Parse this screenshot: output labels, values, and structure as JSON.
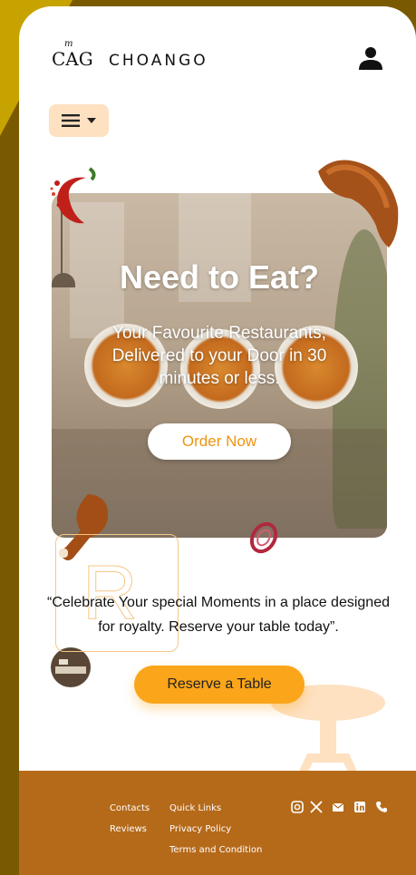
{
  "brand": {
    "mark": "CAG",
    "mark_sub": "m",
    "name": "CHOANGO"
  },
  "header": {
    "user_icon": "user-icon",
    "menu_icon": "hamburger-icon"
  },
  "hero": {
    "title": "Need to Eat?",
    "subtitle": "Your Favourite Restaurants, Delivered to your Door in 30 minutes or less.",
    "cta": "Order Now"
  },
  "quote": {
    "letter": "R",
    "text": "“Celebrate Your special Moments in a place designed for royalty. Reserve your  table today”."
  },
  "reserve": {
    "label": "Reserve a Table"
  },
  "footer": {
    "col1": [
      "Contacts",
      "Reviews"
    ],
    "col2": [
      "Quick Links",
      "Privacy Policy",
      "Terms and Condition"
    ],
    "social": [
      "instagram-icon",
      "x-icon",
      "mail-icon",
      "linkedin-icon",
      "phone-icon"
    ]
  },
  "colors": {
    "accent": "#fba51a",
    "footer_bg": "#b56a1a",
    "menu_bg": "#fde1c0",
    "order_text": "#f0930f"
  }
}
